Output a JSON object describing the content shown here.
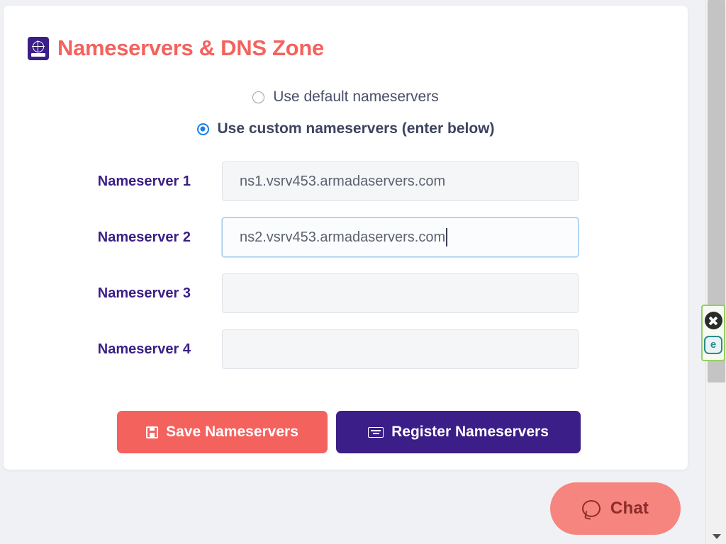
{
  "card": {
    "title": "Nameservers & DNS Zone",
    "title_icon": "passport-globe-icon",
    "title_color": "#f4625e"
  },
  "nameserver_mode": {
    "options": [
      {
        "label": "Use default nameservers",
        "selected": false
      },
      {
        "label": "Use custom nameservers (enter below)",
        "selected": true
      }
    ]
  },
  "nameservers": [
    {
      "label": "Nameserver 1",
      "value": "ns1.vsrv453.armadaservers.com",
      "placeholder": "",
      "focused": false
    },
    {
      "label": "Nameserver 2",
      "value": "ns2.vsrv453.armadaservers.com",
      "placeholder": "",
      "focused": true
    },
    {
      "label": "Nameserver 3",
      "value": "",
      "placeholder": "",
      "focused": false
    },
    {
      "label": "Nameserver 4",
      "value": "",
      "placeholder": "",
      "focused": false
    }
  ],
  "buttons": {
    "save_label": "Save Nameservers",
    "save_icon": "floppy-save-icon",
    "save_color": "#f4625e",
    "register_label": "Register Nameservers",
    "register_icon": "keyboard-icon",
    "register_color": "#3b1e87"
  },
  "chat_widget": {
    "label": "Chat",
    "icon": "chat-bubble-icon",
    "color": "#f6857f"
  },
  "overlay_icons": {
    "close_icon": "close-circle-icon",
    "extension_icon": "e-badge-icon",
    "highlight_color": "#93d162"
  },
  "scrollbar": {
    "down_arrow_icon": "chevron-down-icon"
  }
}
